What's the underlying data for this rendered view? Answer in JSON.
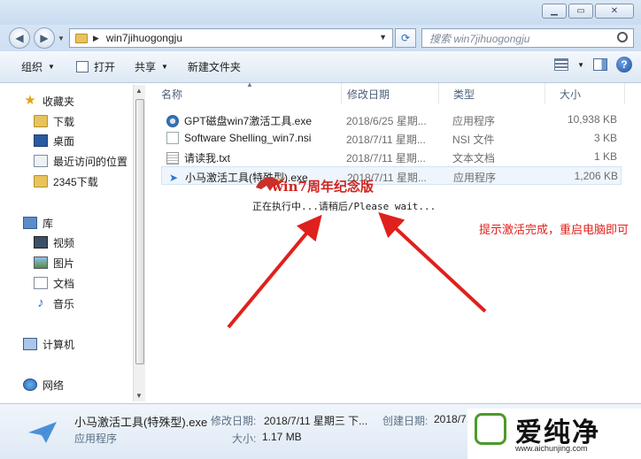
{
  "address": {
    "path": "win7jihuogongju",
    "search_placeholder": "搜索 win7jihuogongju"
  },
  "toolbar": {
    "organize": "组织",
    "open": "打开",
    "share": "共享",
    "new_folder": "新建文件夹"
  },
  "sidebar": {
    "items": [
      {
        "label": "收藏夹",
        "icon": "star-icon"
      },
      {
        "label": "下载",
        "icon": "folder-icon"
      },
      {
        "label": "桌面",
        "icon": "desktop-icon"
      },
      {
        "label": "最近访问的位置",
        "icon": "recent-places-icon"
      },
      {
        "label": "2345下载",
        "icon": "folder-icon"
      },
      {
        "label": "库",
        "icon": "library-icon"
      },
      {
        "label": "视频",
        "icon": "video-icon"
      },
      {
        "label": "图片",
        "icon": "pictures-icon"
      },
      {
        "label": "文档",
        "icon": "documents-icon"
      },
      {
        "label": "音乐",
        "icon": "music-icon"
      },
      {
        "label": "计算机",
        "icon": "computer-icon"
      },
      {
        "label": "网络",
        "icon": "network-icon"
      }
    ]
  },
  "columns": {
    "name": "名称",
    "date": "修改日期",
    "type": "类型",
    "size": "大小"
  },
  "files": [
    {
      "name": "GPT磁盘win7激活工具.exe",
      "date": "2018/6/25 星期...",
      "type": "应用程序",
      "size": "10,938 KB"
    },
    {
      "name": "Software Shelling_win7.nsi",
      "date": "2018/7/11 星期...",
      "type": "NSI 文件",
      "size": "3 KB"
    },
    {
      "name": "请读我.txt",
      "date": "2018/7/11 星期...",
      "type": "文本文档",
      "size": "1 KB"
    },
    {
      "name": "小马激活工具(特殊型).exe",
      "date": "2018/7/11 星期...",
      "type": "应用程序",
      "size": "1,206 KB"
    }
  ],
  "overlay": {
    "title": "win7周年纪念版",
    "status": "正在执行中...请稍后/Please wait..."
  },
  "annotation": "提示激活完成，重启电脑即可",
  "details": {
    "filename": "小马激活工具(特殊型).exe",
    "type": "应用程序",
    "modified_label": "修改日期:",
    "modified_value": "2018/7/11 星期三 下...",
    "created_label": "创建日期:",
    "created_value": "2018/7...",
    "size_label": "大小:",
    "size_value": "1.17 MB"
  },
  "watermark": {
    "text": "爱纯净",
    "url": "www.aichunjing.com"
  },
  "colors": {
    "accent": "#2a76c9",
    "annotation": "#e3201b",
    "arrow": "#e0201c"
  }
}
